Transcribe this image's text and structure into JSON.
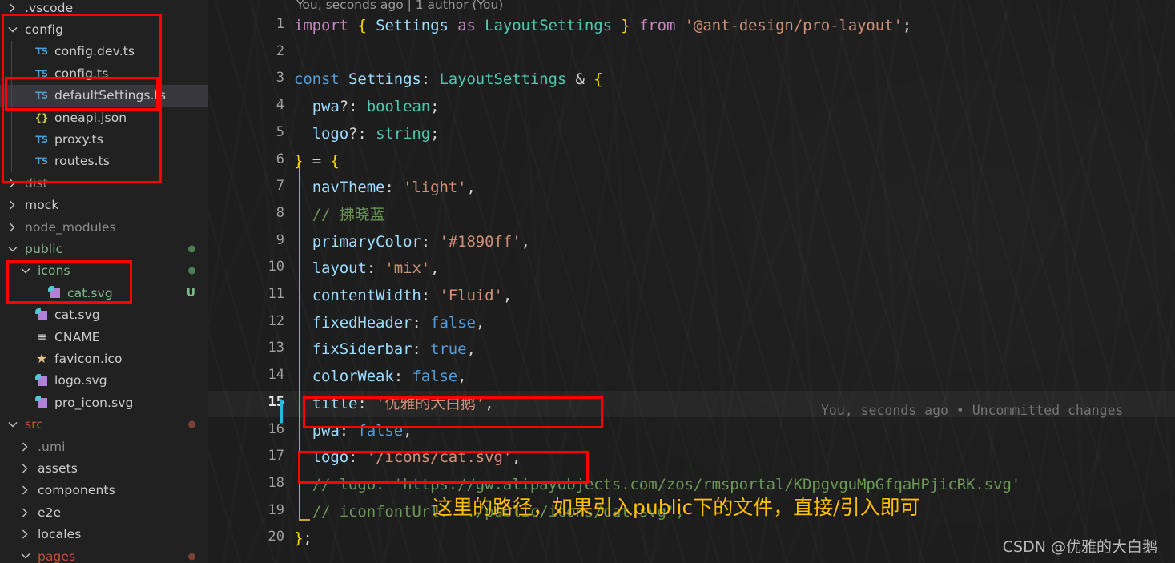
{
  "explorer": {
    "rows": [
      {
        "label": ".vscode",
        "kind": "folder-collapsed",
        "indent": 0,
        "color": "c-white",
        "deco": "",
        "deco_kind": "",
        "selected": false
      },
      {
        "label": "config",
        "kind": "folder-expanded",
        "indent": 0,
        "color": "c-white",
        "deco": "",
        "deco_kind": "",
        "selected": false
      },
      {
        "label": "config.dev.ts",
        "kind": "ts",
        "indent": 1,
        "color": "c-white",
        "deco": "",
        "deco_kind": "",
        "selected": false
      },
      {
        "label": "config.ts",
        "kind": "ts",
        "indent": 1,
        "color": "c-white",
        "deco": "",
        "deco_kind": "",
        "selected": false
      },
      {
        "label": "defaultSettings.ts",
        "kind": "ts",
        "indent": 1,
        "color": "c-white",
        "deco": "",
        "deco_kind": "",
        "selected": true
      },
      {
        "label": "oneapi.json",
        "kind": "json",
        "indent": 1,
        "color": "c-white",
        "deco": "",
        "deco_kind": "",
        "selected": false
      },
      {
        "label": "proxy.ts",
        "kind": "ts",
        "indent": 1,
        "color": "c-white",
        "deco": "",
        "deco_kind": "",
        "selected": false
      },
      {
        "label": "routes.ts",
        "kind": "ts",
        "indent": 1,
        "color": "c-white",
        "deco": "",
        "deco_kind": "",
        "selected": false
      },
      {
        "label": "dist",
        "kind": "folder-collapsed",
        "indent": 0,
        "color": "c-dim",
        "deco": "",
        "deco_kind": "",
        "selected": false
      },
      {
        "label": "mock",
        "kind": "folder-collapsed",
        "indent": 0,
        "color": "c-white",
        "deco": "",
        "deco_kind": "",
        "selected": false
      },
      {
        "label": "node_modules",
        "kind": "folder-collapsed",
        "indent": 0,
        "color": "c-dim",
        "deco": "",
        "deco_kind": "",
        "selected": false
      },
      {
        "label": "public",
        "kind": "folder-expanded",
        "indent": 0,
        "color": "c-green",
        "deco": "",
        "deco_kind": "dot-green",
        "selected": false
      },
      {
        "label": "icons",
        "kind": "folder-expanded",
        "indent": 1,
        "color": "c-green",
        "deco": "",
        "deco_kind": "dot-green",
        "selected": false
      },
      {
        "label": "cat.svg",
        "kind": "svg",
        "indent": 2,
        "color": "c-green",
        "deco": "U",
        "deco_kind": "badge-green",
        "selected": false
      },
      {
        "label": "cat.svg",
        "kind": "svg",
        "indent": 1,
        "color": "c-white",
        "deco": "",
        "deco_kind": "",
        "selected": false
      },
      {
        "label": "CNAME",
        "kind": "list",
        "indent": 1,
        "color": "c-white",
        "deco": "",
        "deco_kind": "",
        "selected": false
      },
      {
        "label": "favicon.ico",
        "kind": "star",
        "indent": 1,
        "color": "c-white",
        "deco": "",
        "deco_kind": "",
        "selected": false
      },
      {
        "label": "logo.svg",
        "kind": "svg",
        "indent": 1,
        "color": "c-white",
        "deco": "",
        "deco_kind": "",
        "selected": false
      },
      {
        "label": "pro_icon.svg",
        "kind": "svg",
        "indent": 1,
        "color": "c-white",
        "deco": "",
        "deco_kind": "",
        "selected": false
      },
      {
        "label": "src",
        "kind": "folder-expanded",
        "indent": 0,
        "color": "c-red",
        "deco": "",
        "deco_kind": "dot-red",
        "selected": false
      },
      {
        "label": ".umi",
        "kind": "folder-collapsed",
        "indent": 1,
        "color": "c-dim",
        "deco": "",
        "deco_kind": "",
        "selected": false
      },
      {
        "label": "assets",
        "kind": "folder-collapsed",
        "indent": 1,
        "color": "c-white",
        "deco": "",
        "deco_kind": "",
        "selected": false
      },
      {
        "label": "components",
        "kind": "folder-collapsed",
        "indent": 1,
        "color": "c-white",
        "deco": "",
        "deco_kind": "",
        "selected": false
      },
      {
        "label": "e2e",
        "kind": "folder-collapsed",
        "indent": 1,
        "color": "c-white",
        "deco": "",
        "deco_kind": "",
        "selected": false
      },
      {
        "label": "locales",
        "kind": "folder-collapsed",
        "indent": 1,
        "color": "c-white",
        "deco": "",
        "deco_kind": "",
        "selected": false
      },
      {
        "label": "pages",
        "kind": "folder-expanded",
        "indent": 1,
        "color": "c-red",
        "deco": "",
        "deco_kind": "dot-red",
        "selected": false
      }
    ]
  },
  "editor": {
    "file": "defaultSettings.ts",
    "blame_header": "You, seconds ago | 1 author (You)",
    "inline_blame_line15": "You, seconds ago • Uncommitted changes",
    "active_line": 15,
    "line_numbers": [
      "1",
      "2",
      "3",
      "4",
      "5",
      "6",
      "7",
      "8",
      "9",
      "10",
      "11",
      "12",
      "13",
      "14",
      "15",
      "16",
      "17",
      "18",
      "19",
      "20"
    ],
    "lines": [
      {
        "n": 1,
        "text": "import { Settings as LayoutSettings } from '@ant-design/pro-layout';"
      },
      {
        "n": 2,
        "text": ""
      },
      {
        "n": 3,
        "text": "const Settings: LayoutSettings & {"
      },
      {
        "n": 4,
        "text": "  pwa?: boolean;"
      },
      {
        "n": 5,
        "text": "  logo?: string;"
      },
      {
        "n": 6,
        "text": "} = {"
      },
      {
        "n": 7,
        "text": "  navTheme: 'light',"
      },
      {
        "n": 8,
        "text": "  // 拂晓蓝"
      },
      {
        "n": 9,
        "text": "  primaryColor: '#1890ff',"
      },
      {
        "n": 10,
        "text": "  layout: 'mix',"
      },
      {
        "n": 11,
        "text": "  contentWidth: 'Fluid',"
      },
      {
        "n": 12,
        "text": "  fixedHeader: false,"
      },
      {
        "n": 13,
        "text": "  fixSiderbar: true,"
      },
      {
        "n": 14,
        "text": "  colorWeak: false,"
      },
      {
        "n": 15,
        "text": "  title: '优雅的大白鹅',"
      },
      {
        "n": 16,
        "text": "  pwa: false,"
      },
      {
        "n": 17,
        "text": "  logo: '/icons/cat.svg',"
      },
      {
        "n": 18,
        "text": "  // logo: 'https://gw.alipayobjects.com/zos/rmsportal/KDpgvguMpGfqaHPjicRK.svg'"
      },
      {
        "n": 19,
        "text": "  // iconfontUrl: './public/icons/cat.svg',"
      },
      {
        "n": 20,
        "text": "};"
      }
    ]
  },
  "annotations": {
    "yellow_note": "这里的路径，如果引入public下的文件，直接/引入即可",
    "red_boxes": 4
  },
  "watermark": "CSDN @优雅的大白鹅",
  "colors": {
    "annotation_red": "#fe0000",
    "annotation_yellow": "#ffc000",
    "editor_bg": "#1d1d1d",
    "sidebar_bg": "#212121",
    "selected_row": "#37373d",
    "cursor": "#29b8db",
    "bracket_guide": "#c8a33c"
  }
}
